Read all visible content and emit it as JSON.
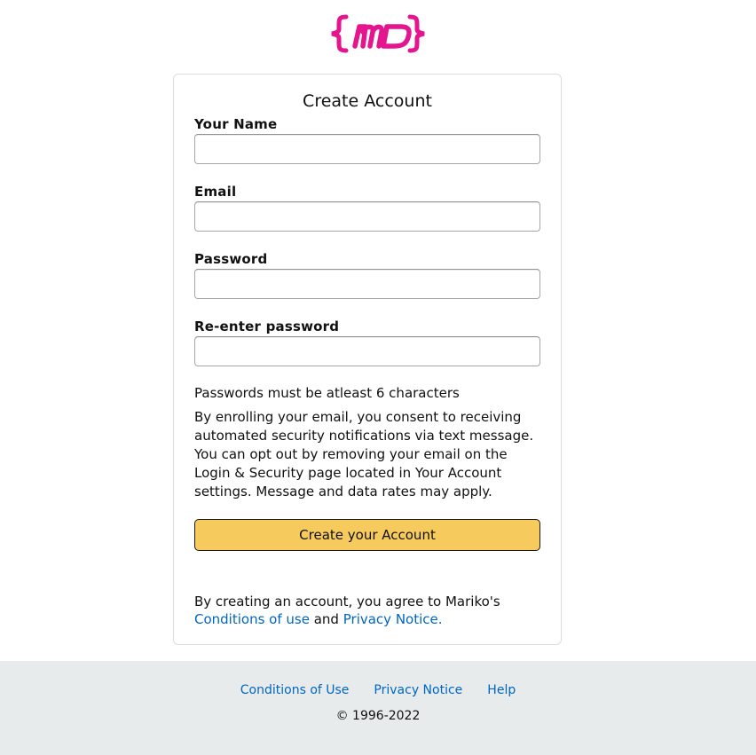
{
  "brand": {
    "logo_text": "{MD}",
    "logo_color": "#e5158f"
  },
  "form": {
    "title": "Create Account",
    "fields": [
      {
        "label": "Your Name",
        "value": "",
        "placeholder": ""
      },
      {
        "label": "Email",
        "value": "",
        "placeholder": ""
      },
      {
        "label": "Password",
        "value": "",
        "placeholder": ""
      },
      {
        "label": "Re-enter password",
        "value": "",
        "placeholder": ""
      }
    ],
    "password_hint": "Passwords must be atleast 6 characters",
    "consent_text": "By enrolling your email, you consent to receiving automated security notifications via text message. You can opt out by removing your email on the Login & Security page located in Your Account settings. Message and data rates may apply.",
    "submit_label": "Create your Account",
    "agree_prefix": "By creating an account, you agree to Mariko's",
    "conditions_link": "Conditions of use",
    "agree_and": "and",
    "privacy_link": "Privacy Notice."
  },
  "footer": {
    "links": [
      "Conditions of Use",
      "Privacy Notice",
      "Help"
    ],
    "copyright": "© 1996-2022"
  },
  "colors": {
    "button_bg": "#f7ca5d",
    "link": "#0066c0",
    "footer_bg": "#e8ebec"
  }
}
